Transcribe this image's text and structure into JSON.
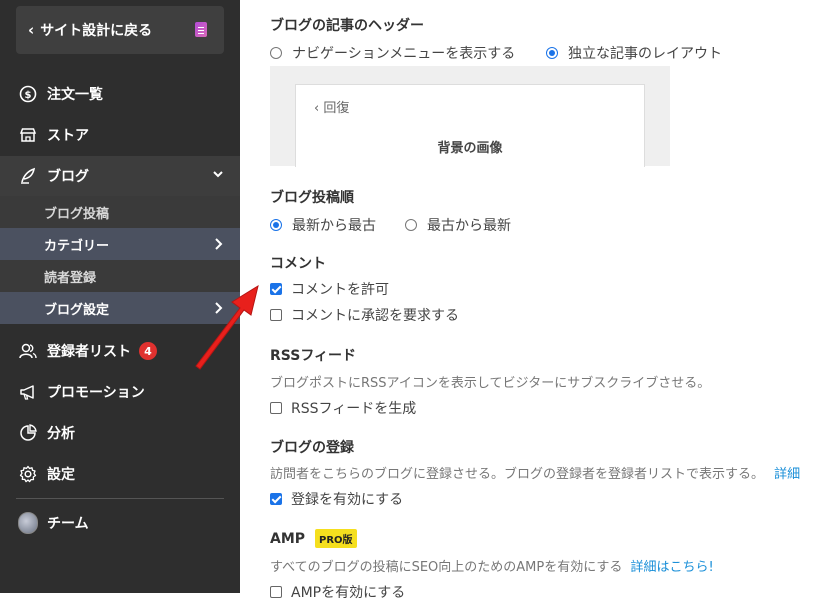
{
  "sidebar": {
    "back_label": "サイト設計に戻る",
    "items": [
      {
        "label": "注文一覧",
        "icon": "dollar-circle-icon"
      },
      {
        "label": "ストア",
        "icon": "store-icon"
      },
      {
        "label": "ブログ",
        "icon": "quill-icon"
      },
      {
        "label": "登録者リスト",
        "icon": "users-icon",
        "badge": "4"
      },
      {
        "label": "プロモーション",
        "icon": "megaphone-icon"
      },
      {
        "label": "分析",
        "icon": "pie-chart-icon"
      },
      {
        "label": "設定",
        "icon": "gear-icon"
      },
      {
        "label": "チーム",
        "icon": "avatar"
      }
    ],
    "blog_sub": [
      {
        "label": "ブログ投稿"
      },
      {
        "label": "カテゴリー"
      },
      {
        "label": "読者登録"
      },
      {
        "label": "ブログ設定"
      }
    ]
  },
  "main": {
    "header_section": {
      "title": "ブログの記事のヘッダー",
      "option1": "ナビゲーションメニューを表示する",
      "option2": "独立な記事のレイアウト",
      "selected": "option2",
      "preview_back": "回復",
      "preview_title": "背景の画像"
    },
    "order_section": {
      "title": "ブログ投稿順",
      "option1": "最新から最古",
      "option2": "最古から最新",
      "selected": "option1"
    },
    "comment_section": {
      "title": "コメント",
      "allow": "コメントを許可",
      "allow_checked": true,
      "approve": "コメントに承認を要求する",
      "approve_checked": false
    },
    "rss_section": {
      "title": "RSSフィード",
      "desc": "ブログポストにRSSアイコンを表示してビジターにサブスクライブさせる。",
      "checkbox": "RSSフィードを生成",
      "checked": false
    },
    "subscribe_section": {
      "title": "ブログの登録",
      "desc": "訪問者をこちらのブログに登録させる。ブログの登録者を登録者リストで表示する。",
      "desc_link": "詳細",
      "checkbox": "登録を有効にする",
      "checked": true
    },
    "amp_section": {
      "title": "AMP",
      "badge": "PRO版",
      "desc": "すべてのブログの投稿にSEO向上のためのAMPを有効にする",
      "desc_link": "詳細はこちら!",
      "checkbox": "AMPを有効にする",
      "checked": false
    }
  },
  "colors": {
    "accent": "#1a73e8",
    "sidebar_bg": "#2e2e2e",
    "arrow": "#e8201c",
    "pro_badge": "#f5df1e"
  }
}
